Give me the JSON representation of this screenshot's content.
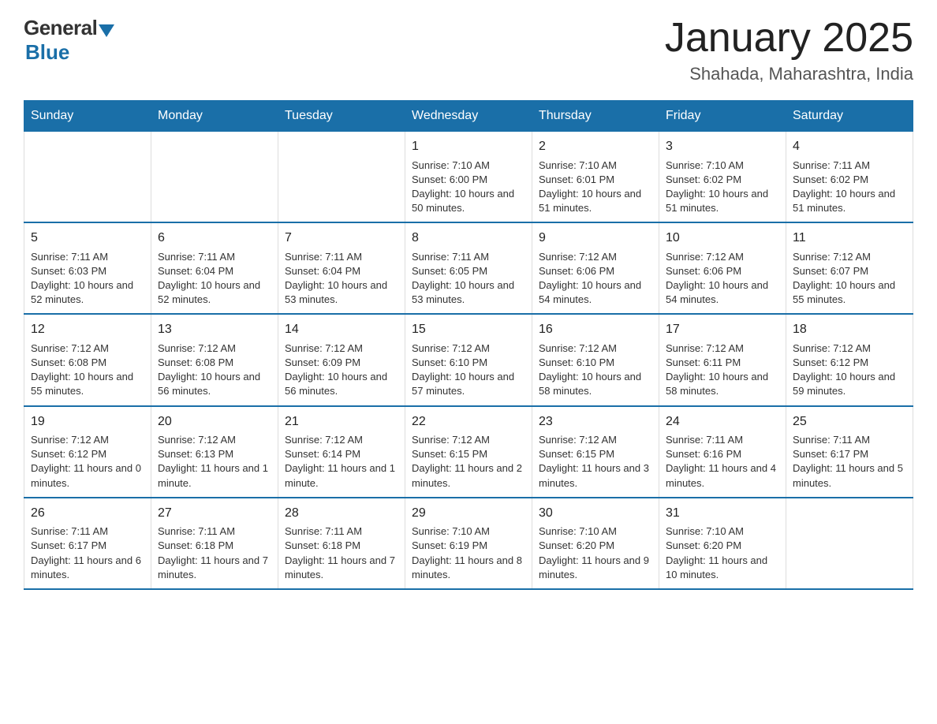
{
  "header": {
    "logo_general": "General",
    "logo_blue": "Blue",
    "title": "January 2025",
    "subtitle": "Shahada, Maharashtra, India"
  },
  "weekdays": [
    "Sunday",
    "Monday",
    "Tuesday",
    "Wednesday",
    "Thursday",
    "Friday",
    "Saturday"
  ],
  "weeks": [
    [
      {
        "day": "",
        "info": ""
      },
      {
        "day": "",
        "info": ""
      },
      {
        "day": "",
        "info": ""
      },
      {
        "day": "1",
        "info": "Sunrise: 7:10 AM\nSunset: 6:00 PM\nDaylight: 10 hours\nand 50 minutes."
      },
      {
        "day": "2",
        "info": "Sunrise: 7:10 AM\nSunset: 6:01 PM\nDaylight: 10 hours\nand 51 minutes."
      },
      {
        "day": "3",
        "info": "Sunrise: 7:10 AM\nSunset: 6:02 PM\nDaylight: 10 hours\nand 51 minutes."
      },
      {
        "day": "4",
        "info": "Sunrise: 7:11 AM\nSunset: 6:02 PM\nDaylight: 10 hours\nand 51 minutes."
      }
    ],
    [
      {
        "day": "5",
        "info": "Sunrise: 7:11 AM\nSunset: 6:03 PM\nDaylight: 10 hours\nand 52 minutes."
      },
      {
        "day": "6",
        "info": "Sunrise: 7:11 AM\nSunset: 6:04 PM\nDaylight: 10 hours\nand 52 minutes."
      },
      {
        "day": "7",
        "info": "Sunrise: 7:11 AM\nSunset: 6:04 PM\nDaylight: 10 hours\nand 53 minutes."
      },
      {
        "day": "8",
        "info": "Sunrise: 7:11 AM\nSunset: 6:05 PM\nDaylight: 10 hours\nand 53 minutes."
      },
      {
        "day": "9",
        "info": "Sunrise: 7:12 AM\nSunset: 6:06 PM\nDaylight: 10 hours\nand 54 minutes."
      },
      {
        "day": "10",
        "info": "Sunrise: 7:12 AM\nSunset: 6:06 PM\nDaylight: 10 hours\nand 54 minutes."
      },
      {
        "day": "11",
        "info": "Sunrise: 7:12 AM\nSunset: 6:07 PM\nDaylight: 10 hours\nand 55 minutes."
      }
    ],
    [
      {
        "day": "12",
        "info": "Sunrise: 7:12 AM\nSunset: 6:08 PM\nDaylight: 10 hours\nand 55 minutes."
      },
      {
        "day": "13",
        "info": "Sunrise: 7:12 AM\nSunset: 6:08 PM\nDaylight: 10 hours\nand 56 minutes."
      },
      {
        "day": "14",
        "info": "Sunrise: 7:12 AM\nSunset: 6:09 PM\nDaylight: 10 hours\nand 56 minutes."
      },
      {
        "day": "15",
        "info": "Sunrise: 7:12 AM\nSunset: 6:10 PM\nDaylight: 10 hours\nand 57 minutes."
      },
      {
        "day": "16",
        "info": "Sunrise: 7:12 AM\nSunset: 6:10 PM\nDaylight: 10 hours\nand 58 minutes."
      },
      {
        "day": "17",
        "info": "Sunrise: 7:12 AM\nSunset: 6:11 PM\nDaylight: 10 hours\nand 58 minutes."
      },
      {
        "day": "18",
        "info": "Sunrise: 7:12 AM\nSunset: 6:12 PM\nDaylight: 10 hours\nand 59 minutes."
      }
    ],
    [
      {
        "day": "19",
        "info": "Sunrise: 7:12 AM\nSunset: 6:12 PM\nDaylight: 11 hours\nand 0 minutes."
      },
      {
        "day": "20",
        "info": "Sunrise: 7:12 AM\nSunset: 6:13 PM\nDaylight: 11 hours\nand 1 minute."
      },
      {
        "day": "21",
        "info": "Sunrise: 7:12 AM\nSunset: 6:14 PM\nDaylight: 11 hours\nand 1 minute."
      },
      {
        "day": "22",
        "info": "Sunrise: 7:12 AM\nSunset: 6:15 PM\nDaylight: 11 hours\nand 2 minutes."
      },
      {
        "day": "23",
        "info": "Sunrise: 7:12 AM\nSunset: 6:15 PM\nDaylight: 11 hours\nand 3 minutes."
      },
      {
        "day": "24",
        "info": "Sunrise: 7:11 AM\nSunset: 6:16 PM\nDaylight: 11 hours\nand 4 minutes."
      },
      {
        "day": "25",
        "info": "Sunrise: 7:11 AM\nSunset: 6:17 PM\nDaylight: 11 hours\nand 5 minutes."
      }
    ],
    [
      {
        "day": "26",
        "info": "Sunrise: 7:11 AM\nSunset: 6:17 PM\nDaylight: 11 hours\nand 6 minutes."
      },
      {
        "day": "27",
        "info": "Sunrise: 7:11 AM\nSunset: 6:18 PM\nDaylight: 11 hours\nand 7 minutes."
      },
      {
        "day": "28",
        "info": "Sunrise: 7:11 AM\nSunset: 6:18 PM\nDaylight: 11 hours\nand 7 minutes."
      },
      {
        "day": "29",
        "info": "Sunrise: 7:10 AM\nSunset: 6:19 PM\nDaylight: 11 hours\nand 8 minutes."
      },
      {
        "day": "30",
        "info": "Sunrise: 7:10 AM\nSunset: 6:20 PM\nDaylight: 11 hours\nand 9 minutes."
      },
      {
        "day": "31",
        "info": "Sunrise: 7:10 AM\nSunset: 6:20 PM\nDaylight: 11 hours\nand 10 minutes."
      },
      {
        "day": "",
        "info": ""
      }
    ]
  ]
}
